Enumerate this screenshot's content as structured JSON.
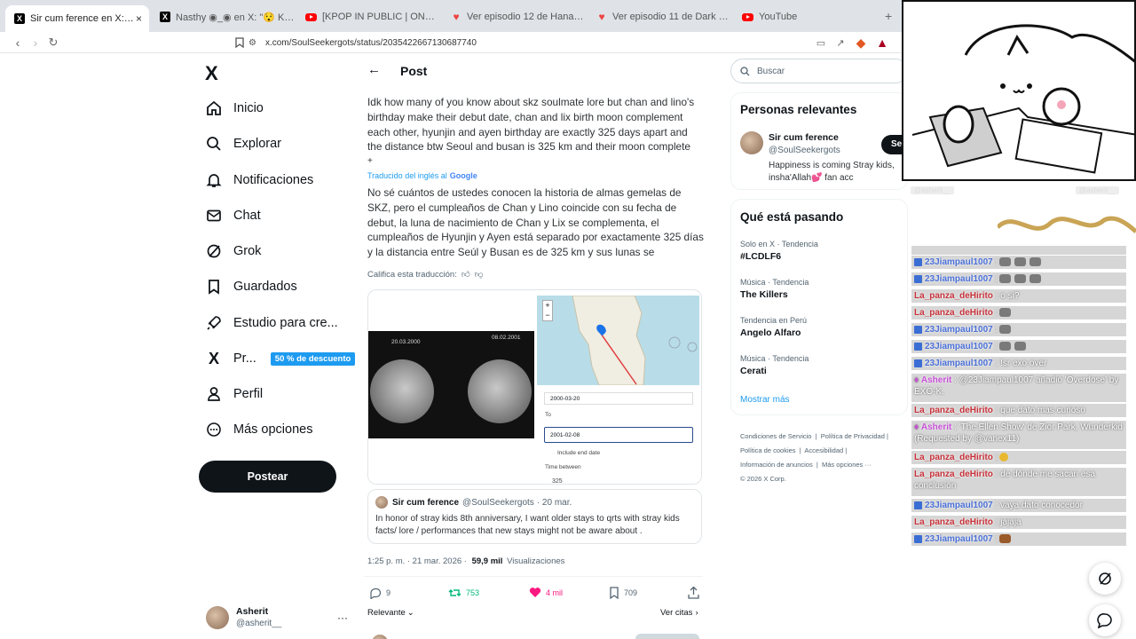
{
  "browser": {
    "tabs": [
      {
        "title": "Sir cum ference en X: \"Idk how m",
        "icon": "x-icon",
        "active": true
      },
      {
        "title": "Nasthy ◉_◉ en X: \"😯 Knowknow",
        "icon": "x-icon",
        "active": false
      },
      {
        "title": "[KPOP IN PUBLIC | ONE TAKE] VIVIZ",
        "icon": "youtube-icon",
        "active": false
      },
      {
        "title": "Ver episodio 12 de Hanazakari no Ki",
        "icon": "crunchyroll-icon",
        "active": false
      },
      {
        "title": "Ver episodio 11 de Dark Moon: Tsuk",
        "icon": "crunchyroll-icon",
        "active": false
      },
      {
        "title": "YouTube",
        "icon": "youtube-icon",
        "active": false
      }
    ],
    "url": "x.com/SoulSeekergots/status/2035422667130687740"
  },
  "nav": {
    "logo": "X",
    "items": [
      {
        "label": "Inicio",
        "icon": "home-icon"
      },
      {
        "label": "Explorar",
        "icon": "search-icon"
      },
      {
        "label": "Notificaciones",
        "icon": "bell-icon"
      },
      {
        "label": "Chat",
        "icon": "mail-icon"
      },
      {
        "label": "Grok",
        "icon": "grok-icon"
      },
      {
        "label": "Guardados",
        "icon": "bookmark-icon"
      },
      {
        "label": "Estudio para cre...",
        "icon": "rocket-icon"
      },
      {
        "label": "Pr...",
        "icon": "x-premium-icon",
        "badge": "50 % de descuento"
      },
      {
        "label": "Perfil",
        "icon": "person-icon"
      },
      {
        "label": "Más opciones",
        "icon": "more-circle-icon"
      }
    ],
    "post_button": "Postear",
    "account": {
      "name": "Asherit",
      "handle": "@asherit__"
    }
  },
  "post": {
    "header": "Post",
    "text": "Idk how many of you know about skz soulmate lore but chan and lino's birthday make their debut date, chan and lix birth moon complement each other, hyunjin and ayen birthday are exactly 325 days apart and the distance btw Seoul and busan is 325 km and their moon complete each",
    "more": "+",
    "translated_by": "Traducido del inglés al",
    "translator": "Google",
    "translation": "No sé cuántos de ustedes conocen la historia de almas gemelas de SKZ, pero el cumpleaños de Chan y Lino coincide con su fecha de debut, la luna de nacimiento de Chan y Lix se complementa, el cumpleaños de Hyunjin y Ayen está separado por exactamente 325 días y la distancia entre Seúl y Busan es de 325 km y sus lunas se complementan entre sí.",
    "rate_translation": "Califica esta traducción:",
    "image": {
      "moon_date_1": "20.03.2000",
      "moon_date_2": "08.02.2001",
      "map_date_from": "2000-03-20",
      "to_label": "To",
      "map_date_to": "2001-02-08",
      "include_end": "Include end date",
      "time_between": "Time between",
      "days": "325",
      "zoom_in": "+",
      "zoom_out": "−"
    },
    "quote": {
      "name": "Sir cum ference",
      "handle": "@SoulSeekergots",
      "date": "· 20 mar.",
      "text": "In honor of stray kids 8th anniversary, I want older stays to qrts with stray kids facts/ lore / performances that new stays might not be aware about ."
    },
    "meta": {
      "time": "1:25 p. m. · 21 mar. 2026 ·",
      "views_count": "59,9 mil",
      "views_label": "Visualizaciones"
    },
    "actions": {
      "replies": "9",
      "reposts": "753",
      "likes": "4 mil",
      "bookmarks": "709"
    },
    "sort_label": "Relevante",
    "quotes_link": "Ver citas"
  },
  "right": {
    "search_placeholder": "Buscar",
    "relevant_title": "Personas relevantes",
    "person": {
      "name": "Sir cum ference",
      "handle": "@SoulSeekergots",
      "bio": "Happiness is coming Stray kids, insha'Allah💕 fan acc",
      "follow": "Se"
    },
    "trending_title": "Qué está pasando",
    "trends": [
      {
        "category": "Solo en X · Tendencia",
        "title": "#LCDLF6"
      },
      {
        "category": "Música · Tendencia",
        "title": "The Killers"
      },
      {
        "category": "Tendencia en Perú",
        "title": "Angelo Alfaro"
      },
      {
        "category": "Música · Tendencia",
        "title": "Cerati"
      }
    ],
    "show_more": "Mostrar más",
    "footer": [
      "Condiciones de Servicio",
      "Política de Privacidad",
      "Política de cookies",
      "Accesibilidad",
      "Información de anuncios",
      "Más opciones ···",
      "© 2026 X Corp."
    ]
  },
  "overlay": {
    "handle_left": "@asherit__",
    "handle_right": "@asherit__",
    "chat": [
      {
        "user": "23Jiampaul1007",
        "msg": ":"
      },
      {
        "user": "23Jiampaul1007",
        "msg": ":"
      },
      {
        "user": "La_panza_deHirito",
        "msg": ": o si?"
      },
      {
        "user": "La_panza_deHirito",
        "msg": ":"
      },
      {
        "user": "23Jiampaul1007",
        "msg": ":"
      },
      {
        "user": "23Jiampaul1007",
        "msg": ":"
      },
      {
        "user": "23Jiampaul1007",
        "msg": ": !sr exo over"
      },
      {
        "user": "Asherit",
        "msg": ": @23Jiampaul1007 añadió 'Overdose' by EXO-K."
      },
      {
        "user": "La_panza_deHirito",
        "msg": ": que dato mas curioso"
      },
      {
        "user": "Asherit",
        "msg": ": 'The Ellen Show' de Zior Park, Wunderkid (Requested by @vanex11)"
      },
      {
        "user": "La_panza_deHirito",
        "msg": ":"
      },
      {
        "user": "La_panza_deHirito",
        "msg": ": de dónde me sacan esa conclusión"
      },
      {
        "user": "23Jiampaul1007",
        "msg": ": vaya dato conocedor"
      },
      {
        "user": "La_panza_deHirito",
        "msg": ": jajaja"
      },
      {
        "user": "23Jiampaul1007",
        "msg": ":"
      }
    ]
  }
}
